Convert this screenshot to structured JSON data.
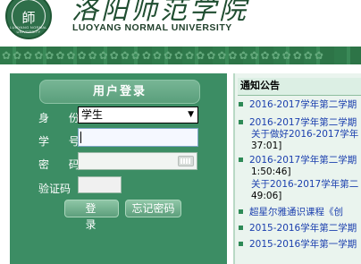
{
  "header": {
    "seal_glyph": "師",
    "seal_ring_text": "LUOYANG NORMAL UNIVERSITY",
    "name_cn": "洛阳师范学院",
    "name_en": "LUOYANG NORMAL UNIVERSITY"
  },
  "login": {
    "title": "用户登录",
    "identity_label": "身 份",
    "identity_value": "学生",
    "student_id_label": "学 号",
    "student_id_value": "",
    "password_label": "密 码",
    "captcha_label": "验证码",
    "login_button": "登 录",
    "forgot_button": "忘记密码"
  },
  "notice": {
    "title": "通知公告",
    "lines": [
      {
        "type": "item",
        "text": "2016-2017学年第二学期"
      },
      {
        "type": "item",
        "text": "2016-2017学年第二学期"
      },
      {
        "type": "cont",
        "text": "关于做好2016-2017学年"
      },
      {
        "type": "ts",
        "text": "37:01]"
      },
      {
        "type": "item",
        "text": "2016-2017学年第二学期"
      },
      {
        "type": "ts",
        "text": "1:50:46]"
      },
      {
        "type": "cont",
        "text": "关于2016-2017学年第二"
      },
      {
        "type": "ts",
        "text": "49:06]"
      },
      {
        "type": "item",
        "text": "超星尔雅通识课程《创"
      },
      {
        "type": "item",
        "text": "2015-2016学年第二学期"
      },
      {
        "type": "item",
        "text": "2015-2016学年第一学期"
      }
    ]
  },
  "colors": {
    "panel_green": "#3c8d64",
    "notice_bg": "#eaf4ee",
    "link_blue": "#1b3fae"
  }
}
